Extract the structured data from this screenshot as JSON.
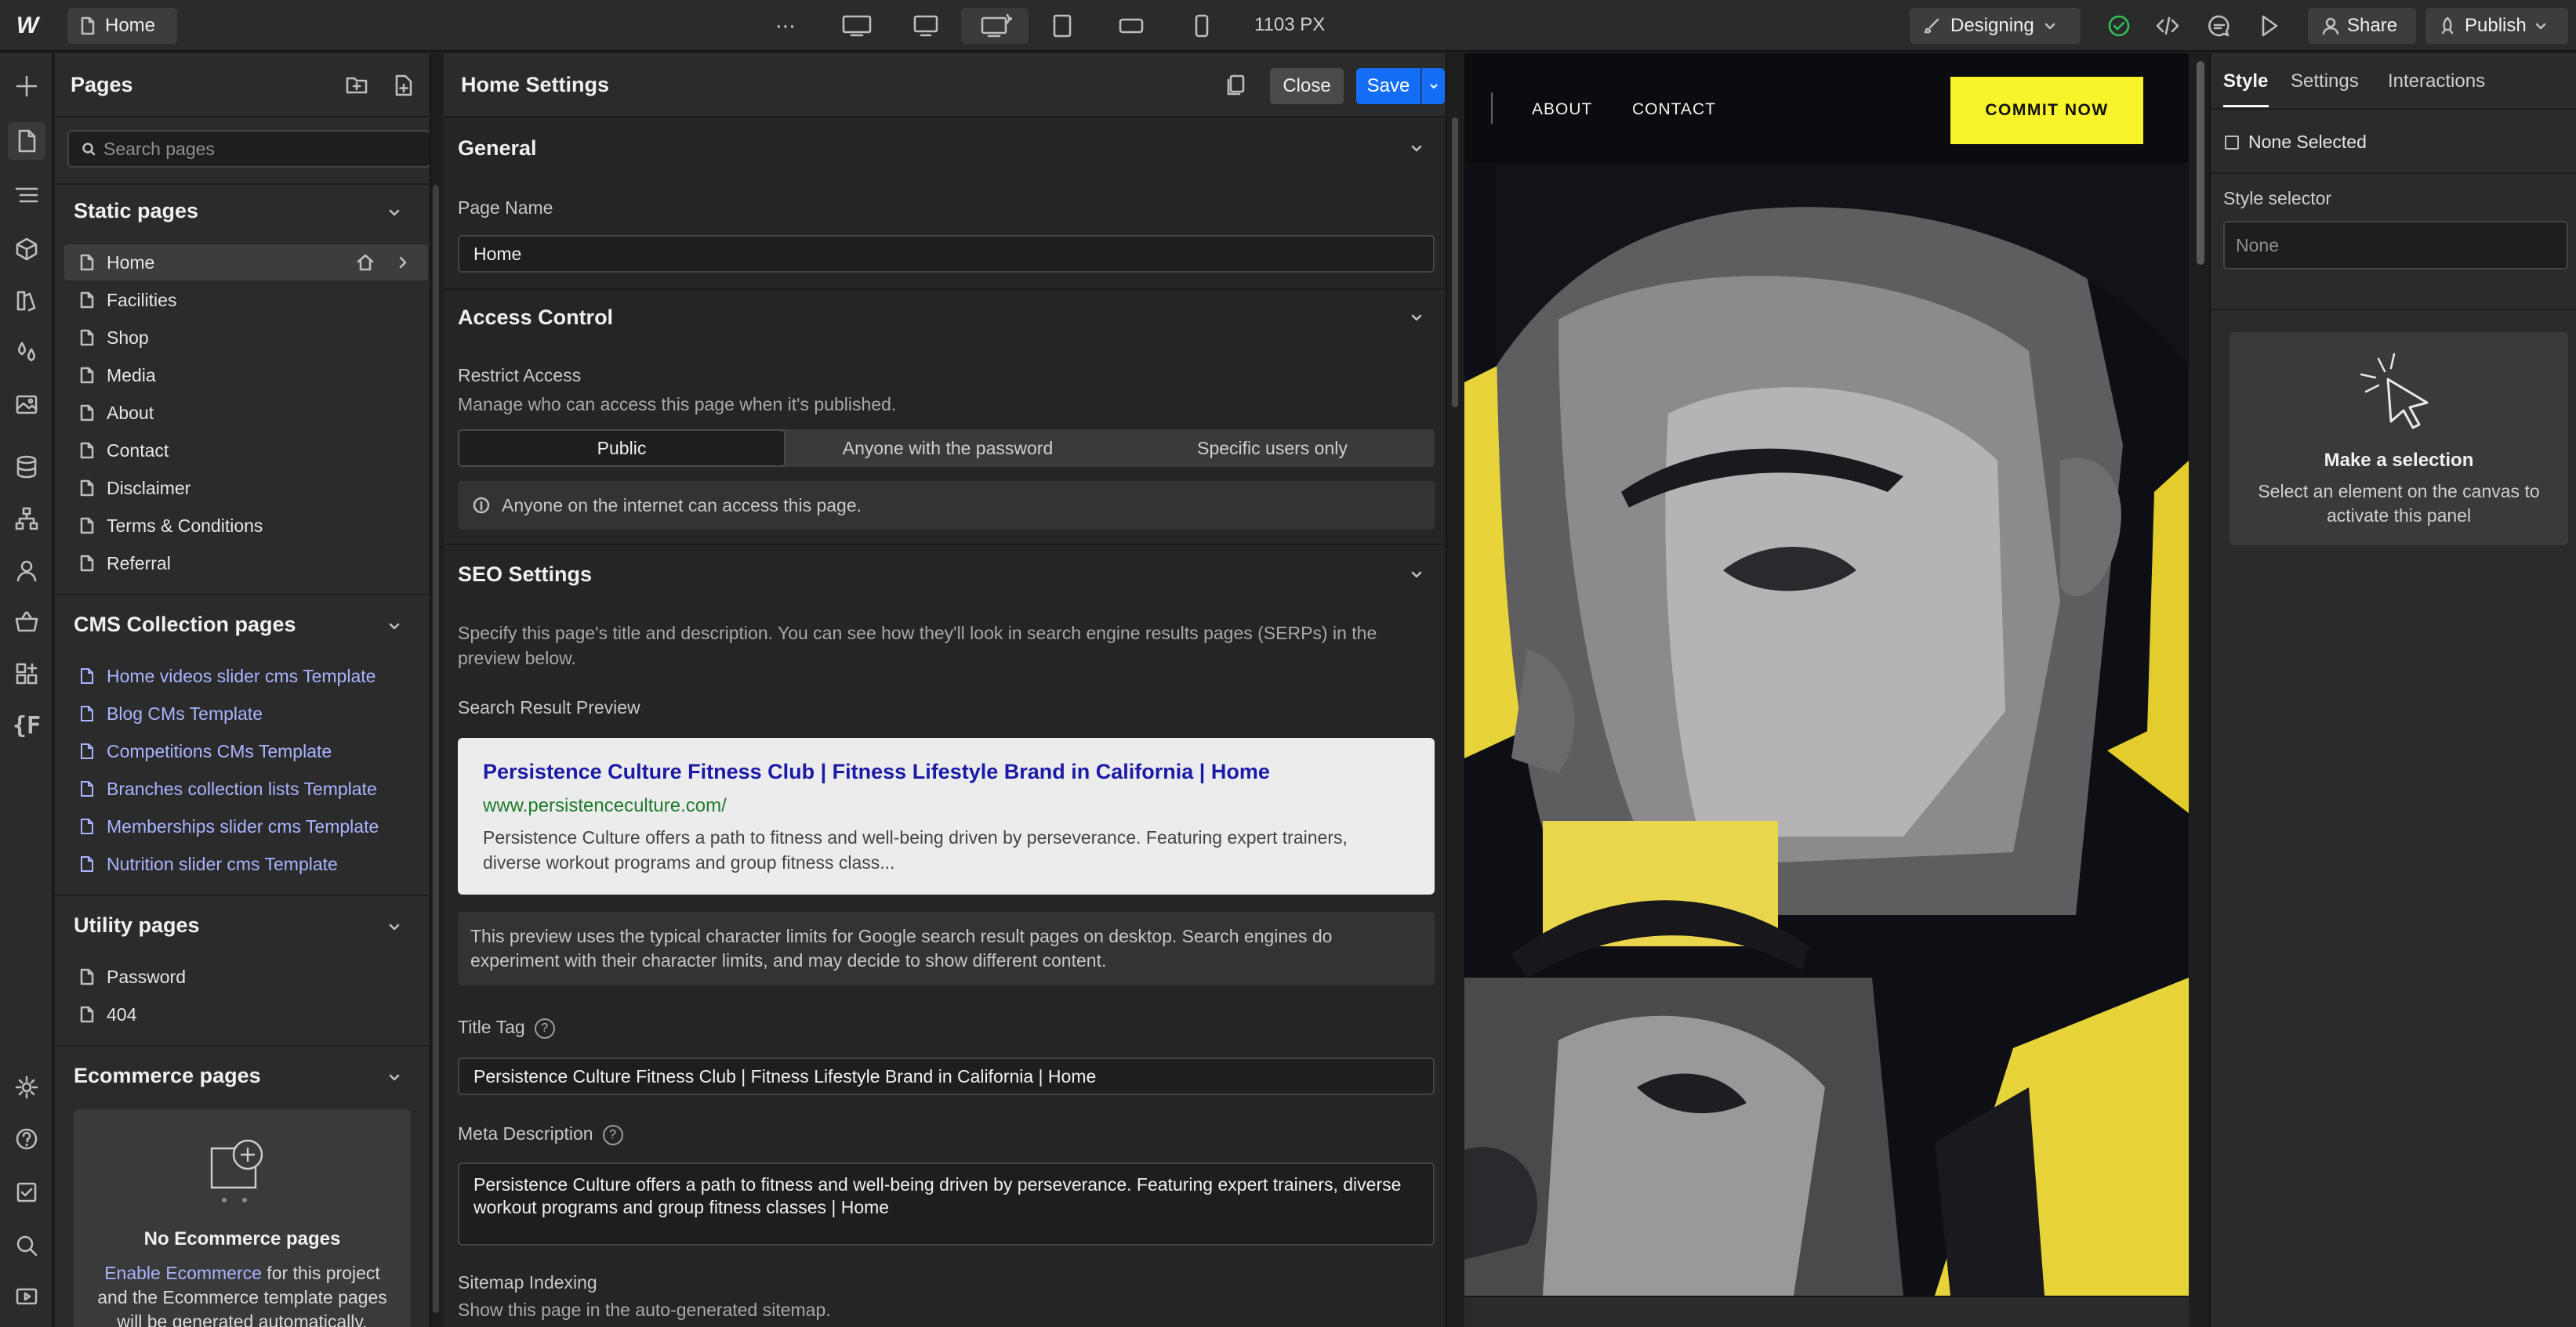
{
  "topbar": {
    "page_chip": "Home",
    "more": "⋯",
    "width_readout": "1103 PX",
    "mode": "Designing",
    "share": "Share",
    "publish": "Publish"
  },
  "pages_panel": {
    "title": "Pages",
    "search_placeholder": "Search pages",
    "static_title": "Static pages",
    "static_pages": [
      "Home",
      "Facilities",
      "Shop",
      "Media",
      "About",
      "Contact",
      "Disclaimer",
      "Terms & Conditions",
      "Referral"
    ],
    "cms_title": "CMS Collection pages",
    "cms_pages": [
      "Home videos slider cms Template",
      "Blog CMs Template",
      "Competitions CMs Template",
      "Branches collection lists Template",
      "Memberships slider cms Template",
      "Nutrition slider cms Template"
    ],
    "utility_title": "Utility pages",
    "utility_pages": [
      "Password",
      "404"
    ],
    "ecommerce_title": "Ecommerce pages",
    "ecommerce_empty_title": "No Ecommerce pages",
    "ecommerce_link": "Enable Ecommerce",
    "ecommerce_text_1": " for this project",
    "ecommerce_text_2": "and the Ecommerce template pages",
    "ecommerce_text_3": "will be generated automatically."
  },
  "settings_panel": {
    "title": "Home Settings",
    "close": "Close",
    "save": "Save",
    "general_title": "General",
    "page_name_label": "Page Name",
    "page_name_value": "Home",
    "access_title": "Access Control",
    "restrict_label": "Restrict Access",
    "restrict_help": "Manage who can access this page when it's published.",
    "access_options": [
      "Public",
      "Anyone with the password",
      "Specific users only"
    ],
    "access_info": "Anyone on the internet can access this page.",
    "seo_title": "SEO Settings",
    "seo_help": "Specify this page's title and description. You can see how they'll look in search engine results pages (SERPs) in the preview below.",
    "serp_label": "Search Result Preview",
    "serp_title": "Persistence Culture Fitness Club | Fitness Lifestyle Brand in California | Home",
    "serp_url": "www.persistenceculture.com/",
    "serp_desc": "Persistence Culture offers a path to fitness and well-being driven by perseverance. Featuring expert trainers, diverse workout programs and group fitness class...",
    "serp_note": "This preview uses the typical character limits for Google search result pages on desktop. Search engines do experiment with their character limits, and may decide to show different content.",
    "title_tag_label": "Title Tag",
    "title_tag_value": "Persistence Culture Fitness Club | Fitness Lifestyle Brand in California | Home",
    "meta_label": "Meta Description",
    "meta_value": "Persistence Culture offers a path to fitness and well-being driven by perseverance. Featuring expert trainers, diverse workout programs and group fitness classes | Home",
    "sitemap_label": "Sitemap Indexing",
    "sitemap_help": "Show this page in the auto-generated sitemap."
  },
  "canvas": {
    "nav_about": "ABOUT",
    "nav_contact": "CONTACT",
    "cta": "COMMIT NOW"
  },
  "style_panel": {
    "tabs": [
      "Style",
      "Settings",
      "Interactions"
    ],
    "none_selected": "None Selected",
    "selector_label": "Style selector",
    "selector_value": "None",
    "empty_title": "Make a selection",
    "empty_text": "Select an element on the canvas to activate this panel"
  },
  "colors": {
    "accent_blue": "#146ef5",
    "cta_yellow": "#f8f32b",
    "cms_link": "#a9b4ff",
    "status_green": "#2fbf5b"
  }
}
